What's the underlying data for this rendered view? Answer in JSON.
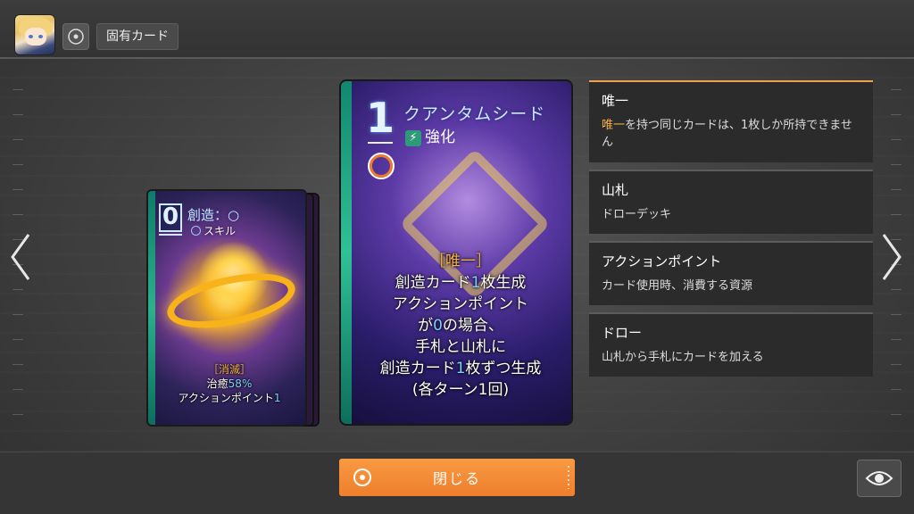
{
  "header": {
    "tag_label": "固有カード"
  },
  "small_card": {
    "cost": "0",
    "name": "創造：○",
    "type": "スキル",
    "effect_keyword": "［消滅］",
    "effect_line2_prefix": "治癒",
    "effect_line2_value": "58%",
    "effect_line3_prefix": "アクションポイント",
    "effect_line3_value": "1"
  },
  "main_card": {
    "cost": "1",
    "name": "クアンタムシード",
    "type": "強化",
    "effect_keyword": "［唯一］",
    "effect_l1a": "創造カード",
    "effect_l1b": "1",
    "effect_l1c": "枚生成",
    "effect_l2": "アクションポイント",
    "effect_l3a": "が",
    "effect_l3b": "0",
    "effect_l3c": "の場合、",
    "effect_l4": "手札と山札に",
    "effect_l5a": "創造カード",
    "effect_l5b": "1",
    "effect_l5c": "枚ずつ生成",
    "effect_l6": "(各ターン1回)"
  },
  "glossary": [
    {
      "title": "唯一",
      "body_highlight": "唯一",
      "body": "を持つ同じカードは、1枚しか所持できません"
    },
    {
      "title": "山札",
      "body": "ドローデッキ"
    },
    {
      "title": "アクションポイント",
      "body": "カード使用時、消費する資源"
    },
    {
      "title": "ドロー",
      "body": "山札から手札にカードを加える"
    }
  ],
  "footer": {
    "close_label": "閉じる"
  },
  "colors": {
    "accent": "#f08a36",
    "highlight": "#f6b24a",
    "number_blue": "#7fd0ff"
  }
}
